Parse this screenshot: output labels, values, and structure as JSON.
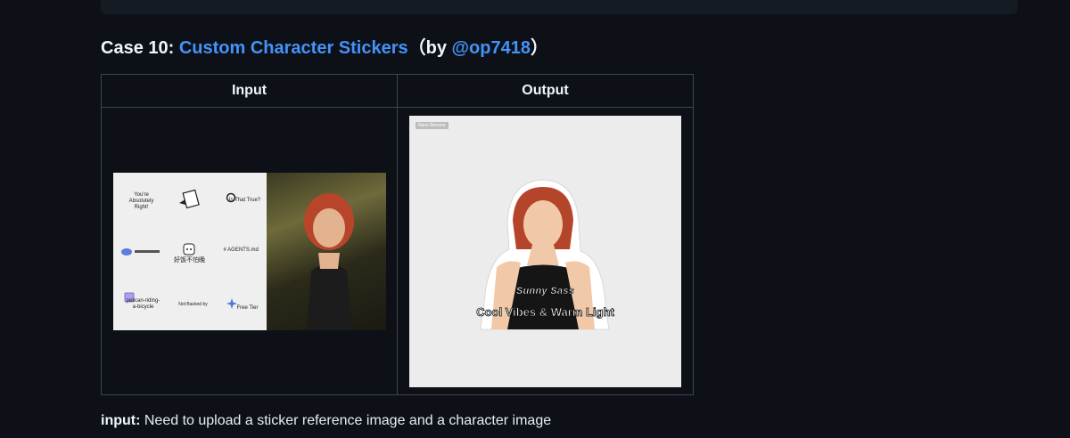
{
  "case": {
    "prefix": "Case 10: ",
    "title_link": "Custom Character Stickers",
    "by_open": "（by ",
    "author": "@op7418",
    "by_close": "）"
  },
  "table": {
    "headers": [
      "Input",
      "Output"
    ]
  },
  "input_stickers": [
    "You're Absolutely Right!",
    "Is That True?",
    "好饭不怕晚",
    "# AGENTS.md",
    "pelican-riding-a-bicycle",
    "Not Backed by",
    "Free Tier"
  ],
  "output": {
    "badge": "Nano Banana",
    "caption_small": "Sunny Sass",
    "caption_large": "Cool Vibes & Warm Light"
  },
  "note": {
    "label": "input:",
    "text": " Need to upload a sticker reference image and a character image"
  },
  "colors": {
    "background": "#0d1117",
    "link": "#4493f8",
    "border": "#3d444d"
  }
}
